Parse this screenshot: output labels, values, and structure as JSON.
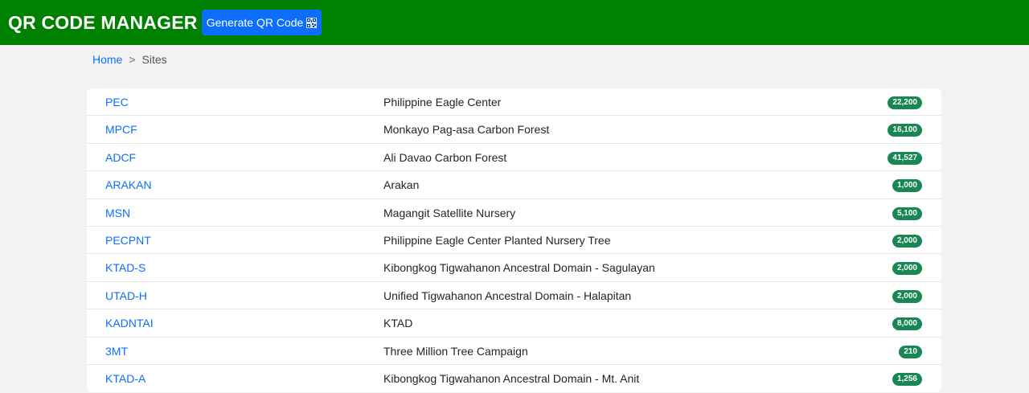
{
  "header": {
    "title": "QR CODE MANAGER",
    "generate_button_label": "Generate QR Code",
    "generate_button_icon": "qr-code-icon",
    "background_color": "#008000",
    "button_color": "#0d6efd"
  },
  "breadcrumb": {
    "home": "Home",
    "separator": ">",
    "current": "Sites"
  },
  "sites": [
    {
      "code": "PEC",
      "name": "Philippine Eagle Center",
      "count": "22,200"
    },
    {
      "code": "MPCF",
      "name": "Monkayo Pag-asa Carbon Forest",
      "count": "16,100"
    },
    {
      "code": "ADCF",
      "name": "Ali Davao Carbon Forest",
      "count": "41,527"
    },
    {
      "code": "ARAKAN",
      "name": "Arakan",
      "count": "1,000"
    },
    {
      "code": "MSN",
      "name": "Magangit Satellite Nursery",
      "count": "5,100"
    },
    {
      "code": "PECPNT",
      "name": "Philippine Eagle Center Planted Nursery Tree",
      "count": "2,000"
    },
    {
      "code": "KTAD-S",
      "name": "Kibongkog Tigwahanon Ancestral Domain - Sagulayan",
      "count": "2,000"
    },
    {
      "code": "UTAD-H",
      "name": "Unified Tigwahanon Ancestral Domain - Halapitan",
      "count": "2,000"
    },
    {
      "code": "KADNTAI",
      "name": "KTAD",
      "count": "8,000"
    },
    {
      "code": "3MT",
      "name": "Three Million Tree Campaign",
      "count": "210"
    },
    {
      "code": "KTAD-A",
      "name": "Kibongkog Tigwahanon Ancestral Domain - Mt. Anit",
      "count": "1,256"
    }
  ],
  "badge_color": "#198754"
}
